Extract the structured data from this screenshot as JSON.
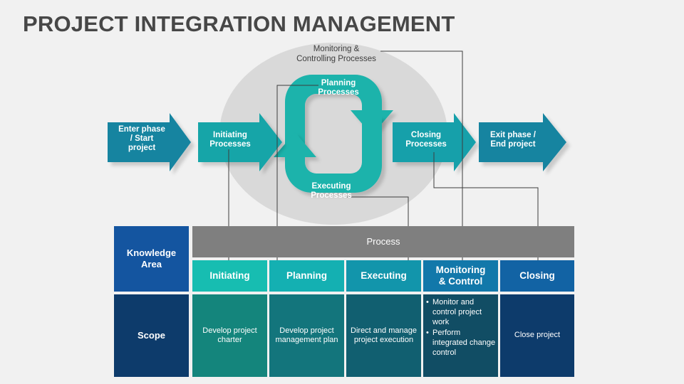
{
  "page": {
    "title": "PROJECT INTEGRATION MANAGEMENT",
    "background_color": "#f1f1f1",
    "title_color": "#474747"
  },
  "diagram": {
    "ellipse_color": "#d9d9d9",
    "monitoring_label": "Monitoring &\nControlling Processes",
    "monitoring_label_line1": "Monitoring &",
    "monitoring_label_line2": "Controlling Processes",
    "arrows": [
      {
        "id": "enter-phase",
        "label": "Enter phase\n/ Start\nproject",
        "line1": "Enter phase",
        "line2": "/ Start",
        "line3": "project",
        "color": "#1584a0"
      },
      {
        "id": "initiating",
        "label": "Initiating\nProcesses",
        "line1": "Initiating",
        "line2": "Processes",
        "color": "#14a5a8"
      },
      {
        "id": "planning",
        "label": "Planning\nProcesses",
        "line1": "Planning",
        "line2": "Processes",
        "color": "#1bb3ab"
      },
      {
        "id": "executing",
        "label": "Executing\nProcesses",
        "line1": "Executing",
        "line2": "Processes",
        "color": "#1bb3ab"
      },
      {
        "id": "closing",
        "label": "Closing\nProcesses",
        "line1": "Closing",
        "line2": "Processes",
        "color": "#14a0aa"
      },
      {
        "id": "exit-phase",
        "label": "Exit phase /\nEnd project",
        "line1": "Exit phase /",
        "line2": "End project",
        "color": "#1584a0"
      }
    ]
  },
  "table": {
    "row_header_1": "Knowledge Area",
    "row_header_1_line1": "Knowledge",
    "row_header_1_line2": "Area",
    "row_header_2": "Scope",
    "group_header": "Process",
    "group_header_color": "#7f7f7f",
    "columns": [
      {
        "phase": "Initiating",
        "phase_line1": "Initiating",
        "phase_line2": "",
        "phase_color": "#17bdb1",
        "detail_color": "#14857c",
        "detail_type": "text",
        "detail_text": "Develop project charter"
      },
      {
        "phase": "Planning",
        "phase_line1": "Planning",
        "phase_line2": "",
        "phase_color": "#14b0b2",
        "detail_color": "#13757c",
        "detail_type": "text",
        "detail_text": "Develop project management plan"
      },
      {
        "phase": "Executing",
        "phase_line1": "Executing",
        "phase_line2": "",
        "phase_color": "#1295ab",
        "detail_color": "#115f70",
        "detail_type": "text",
        "detail_text": "Direct and manage project execution"
      },
      {
        "phase": "Monitoring & Control",
        "phase_line1": "Monitoring",
        "phase_line2": "& Control",
        "phase_color": "#1278aa",
        "detail_color": "#114d64",
        "detail_type": "bullets",
        "detail_bullets": [
          "Monitor and control project work",
          "Perform integrated change control"
        ]
      },
      {
        "phase": "Closing",
        "phase_line1": "Closing",
        "phase_line2": "",
        "phase_color": "#1263a4",
        "detail_color": "#0d3b6b",
        "detail_type": "text",
        "detail_text": "Close project"
      }
    ]
  }
}
